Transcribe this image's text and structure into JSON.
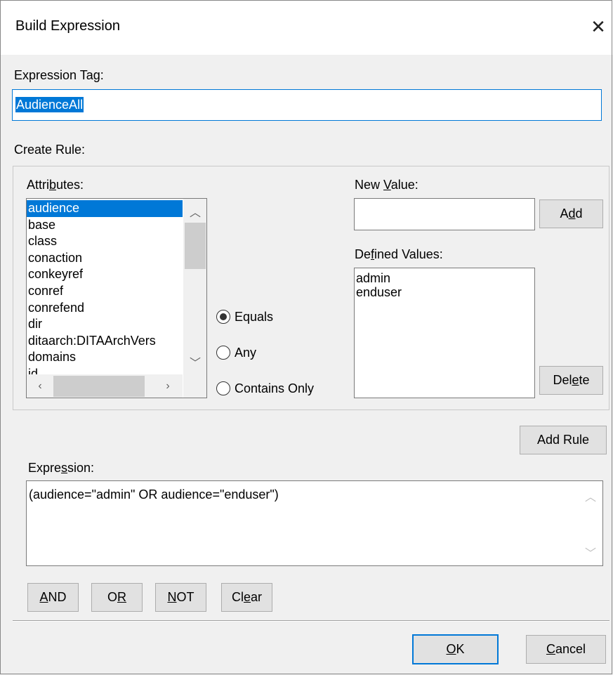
{
  "window": {
    "title": "Build Expression",
    "close_glyph": "✕"
  },
  "expression_tag": {
    "label": "Expression Tag:",
    "value": "AudienceAll"
  },
  "create_rule": {
    "label": "Create Rule:",
    "attributes": {
      "label_pre": "Attri",
      "label_ul": "b",
      "label_post": "utes:",
      "items": [
        "audience",
        "base",
        "class",
        "conaction",
        "conkeyref",
        "conref",
        "conrefend",
        "dir",
        "ditaarch:DITAArchVers",
        "domains",
        "id"
      ],
      "selected_index": 0
    },
    "operators": {
      "options": [
        "Equals",
        "Any",
        "Contains Only"
      ],
      "selected_index": 0
    },
    "new_value": {
      "label_pre": "New ",
      "label_ul": "V",
      "label_post": "alue:",
      "value": ""
    },
    "add_button": {
      "pre": "A",
      "ul": "d",
      "post": "d"
    },
    "defined_values": {
      "label_pre": "De",
      "label_ul": "f",
      "label_post": "ined Values:",
      "items": [
        "admin",
        "enduser"
      ]
    },
    "delete_button": {
      "pre": "Del",
      "ul": "e",
      "post": "te"
    }
  },
  "add_rule_button": "Add Rule",
  "expression": {
    "label_pre": "Expre",
    "label_ul": "s",
    "label_post": "sion:",
    "value": "(audience=\"admin\" OR audience=\"enduser\")"
  },
  "logic_buttons": [
    {
      "pre": "",
      "ul": "A",
      "post": "ND"
    },
    {
      "pre": "O",
      "ul": "R",
      "post": ""
    },
    {
      "pre": "",
      "ul": "N",
      "post": "OT"
    },
    {
      "pre": "Cl",
      "ul": "e",
      "post": "ar"
    }
  ],
  "ok_button": {
    "pre": "",
    "ul": "O",
    "post": "K"
  },
  "cancel_button": {
    "pre": "",
    "ul": "C",
    "post": "ancel"
  },
  "colors": {
    "accent": "#0078d7",
    "dialog_bg": "#f0f0f0"
  }
}
